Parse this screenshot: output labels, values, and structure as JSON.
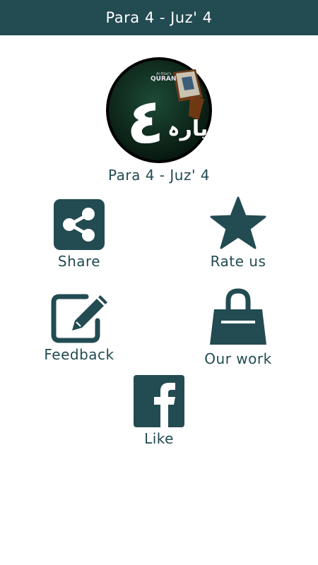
{
  "app_bar": {
    "title": "Para 4 - Juz' 4"
  },
  "logo": {
    "badge_small": "Al-Hilal's",
    "badge_brand": "QURAN",
    "numeral": "٤",
    "urdu_text": "پارہ"
  },
  "subtitle": "Para 4 - Juz' 4",
  "actions": {
    "share": {
      "label": "Share",
      "icon": "share-icon"
    },
    "rate": {
      "label": "Rate us",
      "icon": "star-icon"
    },
    "feedback": {
      "label": "Feedback",
      "icon": "edit-icon"
    },
    "our_work": {
      "label": "Our work",
      "icon": "shopping-bag-icon"
    },
    "like": {
      "label": "Like",
      "icon": "facebook-icon"
    }
  },
  "colors": {
    "primary": "#224b52",
    "logo_bg": "#0f2a1f",
    "background": "#ffffff"
  }
}
